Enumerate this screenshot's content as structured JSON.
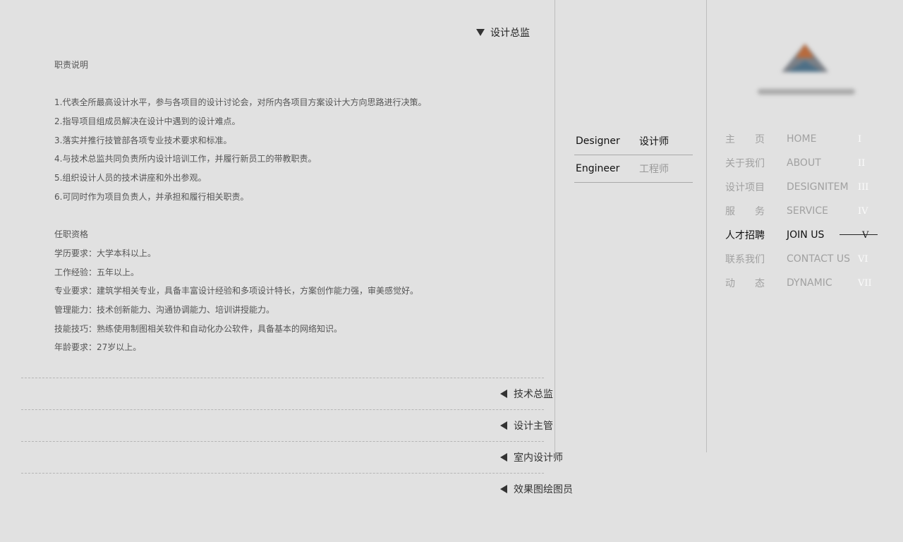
{
  "job": {
    "current_title": "设计总监",
    "sections": [
      "职责说明",
      "",
      "1.代表全所最高设计水平，参与各项目的设计讨论会，对所内各项目方案设计大方向思路进行决策。",
      "2.指导项目组成员解决在设计中遇到的设计难点。",
      "3.落实并推行技管部各项专业技术要求和标准。",
      "4.与技术总监共同负责所内设计培训工作，并履行新员工的带教职责。",
      "5.组织设计人员的技术讲座和外出参观。",
      "6.可同时作为项目负责人，并承担和履行相关职责。",
      "",
      "任职资格",
      "学历要求：大学本科以上。",
      "工作经验：五年以上。",
      "专业要求：建筑学相关专业，具备丰富设计经验和多项设计特长，方案创作能力强，审美感觉好。",
      "管理能力：技术创新能力、沟通协调能力、培训讲授能力。",
      "技能技巧：熟练使用制图相关软件和自动化办公软件，具备基本的网络知识。",
      "年龄要求：27岁以上。"
    ],
    "other_positions": [
      "技术总监",
      "设计主管",
      "室内设计师",
      "效果图绘图员"
    ]
  },
  "categories": [
    {
      "en": "Designer",
      "cn": "设计师",
      "active": true
    },
    {
      "en": "Engineer",
      "cn": "工程师",
      "active": false
    }
  ],
  "nav": [
    {
      "cn": "主　　页",
      "en": "HOME",
      "num": "I",
      "active": false
    },
    {
      "cn": "关于我们",
      "en": "ABOUT",
      "num": "II",
      "active": false
    },
    {
      "cn": "设计项目",
      "en": "DESIGNITEM",
      "num": "III",
      "active": false
    },
    {
      "cn": "服　　务",
      "en": "SERVICE",
      "num": "IV",
      "active": false
    },
    {
      "cn": "人才招聘",
      "en": "JOIN US",
      "num": "V",
      "active": true
    },
    {
      "cn": "联系我们",
      "en": "CONTACT US",
      "num": "VI",
      "active": false
    },
    {
      "cn": "动　　态",
      "en": "DYNAMIC",
      "num": "VII",
      "active": false
    }
  ],
  "colors": {
    "background": "#e1e1e1",
    "active_text": "#111111",
    "inactive_text": "#a1a1a1"
  }
}
